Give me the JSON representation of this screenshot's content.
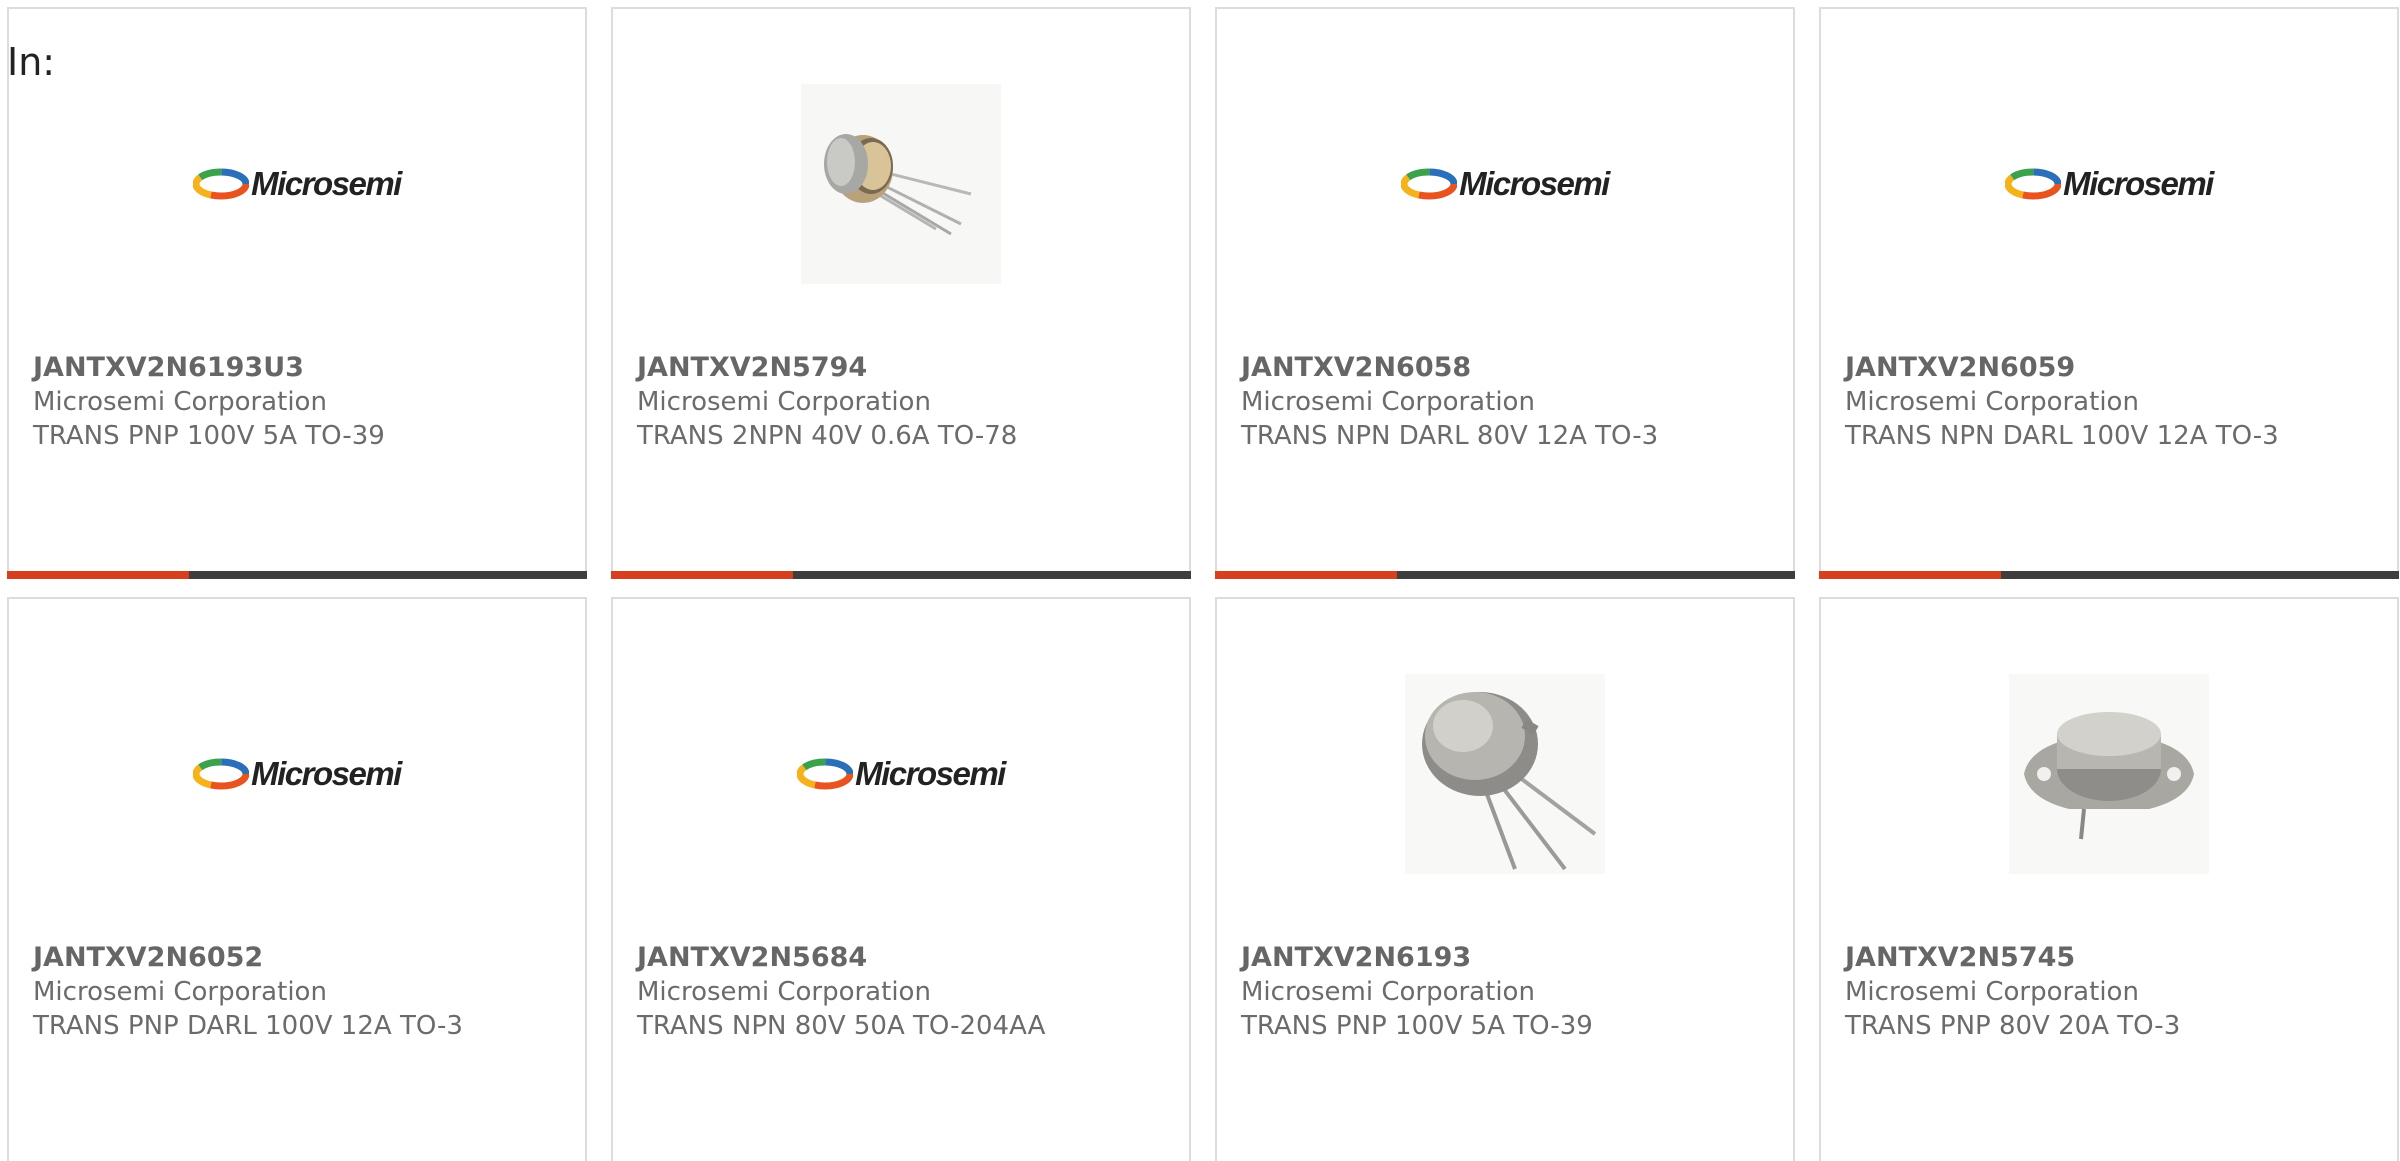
{
  "page": {
    "label": "In:"
  },
  "brand": {
    "logo_text": "Microsemi",
    "accent_color": "#d6401f",
    "bar_color": "#3e3e3e"
  },
  "products": [
    {
      "part_number": "JANTXV2N6193U3",
      "manufacturer": "Microsemi Corporation",
      "description": "TRANS PNP 100V 5A TO-39",
      "image": "microsemi-logo"
    },
    {
      "part_number": "JANTXV2N5794",
      "manufacturer": "Microsemi Corporation",
      "description": "TRANS 2NPN 40V 0.6A TO-78",
      "image": "to-78-can-transistor-photo"
    },
    {
      "part_number": "JANTXV2N6058",
      "manufacturer": "Microsemi Corporation",
      "description": "TRANS NPN DARL 80V 12A TO-3",
      "image": "microsemi-logo"
    },
    {
      "part_number": "JANTXV2N6059",
      "manufacturer": "Microsemi Corporation",
      "description": "TRANS NPN DARL 100V 12A TO-3",
      "image": "microsemi-logo"
    },
    {
      "part_number": "JANTXV2N6052",
      "manufacturer": "Microsemi Corporation",
      "description": "TRANS PNP DARL 100V 12A TO-3",
      "image": "microsemi-logo"
    },
    {
      "part_number": "JANTXV2N5684",
      "manufacturer": "Microsemi Corporation",
      "description": "TRANS NPN 80V 50A TO-204AA",
      "image": "microsemi-logo"
    },
    {
      "part_number": "JANTXV2N6193",
      "manufacturer": "Microsemi Corporation",
      "description": "TRANS PNP 100V 5A TO-39",
      "image": "to-39-can-transistor-photo"
    },
    {
      "part_number": "JANTXV2N5745",
      "manufacturer": "Microsemi Corporation",
      "description": "TRANS PNP 80V 20A TO-3",
      "image": "to-3-transistor-photo"
    }
  ]
}
